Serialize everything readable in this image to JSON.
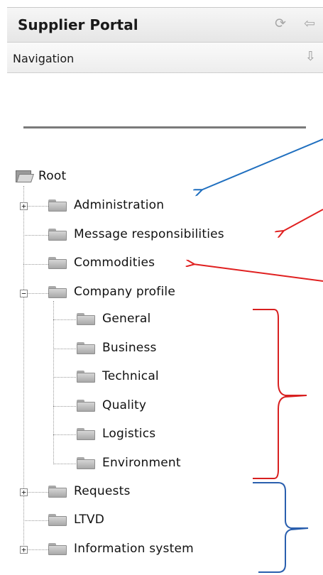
{
  "header": {
    "title": "Supplier Portal",
    "icons": [
      "refresh-icon",
      "back-arrow-icon"
    ]
  },
  "subheader": {
    "title": "Navigation",
    "icons": [
      "down-arrow-icon"
    ]
  },
  "tree": {
    "root_label": "Root",
    "items": [
      {
        "label": "Administration",
        "expander": "+"
      },
      {
        "label": "Message responsibilities"
      },
      {
        "label": "Commodities"
      },
      {
        "label": "Company profile",
        "expander": "−",
        "children": [
          {
            "label": "General"
          },
          {
            "label": "Business"
          },
          {
            "label": "Technical"
          },
          {
            "label": "Quality"
          },
          {
            "label": "Logistics"
          },
          {
            "label": "Environment"
          }
        ]
      },
      {
        "label": "Requests",
        "expander": "+"
      },
      {
        "label": "LTVD"
      },
      {
        "label": "Information system",
        "expander": "+"
      }
    ]
  },
  "annotation_colors": {
    "blue": "#1f6fbf",
    "red": "#e02020",
    "bracket_red": "#d82020",
    "bracket_blue": "#2a5fae"
  }
}
